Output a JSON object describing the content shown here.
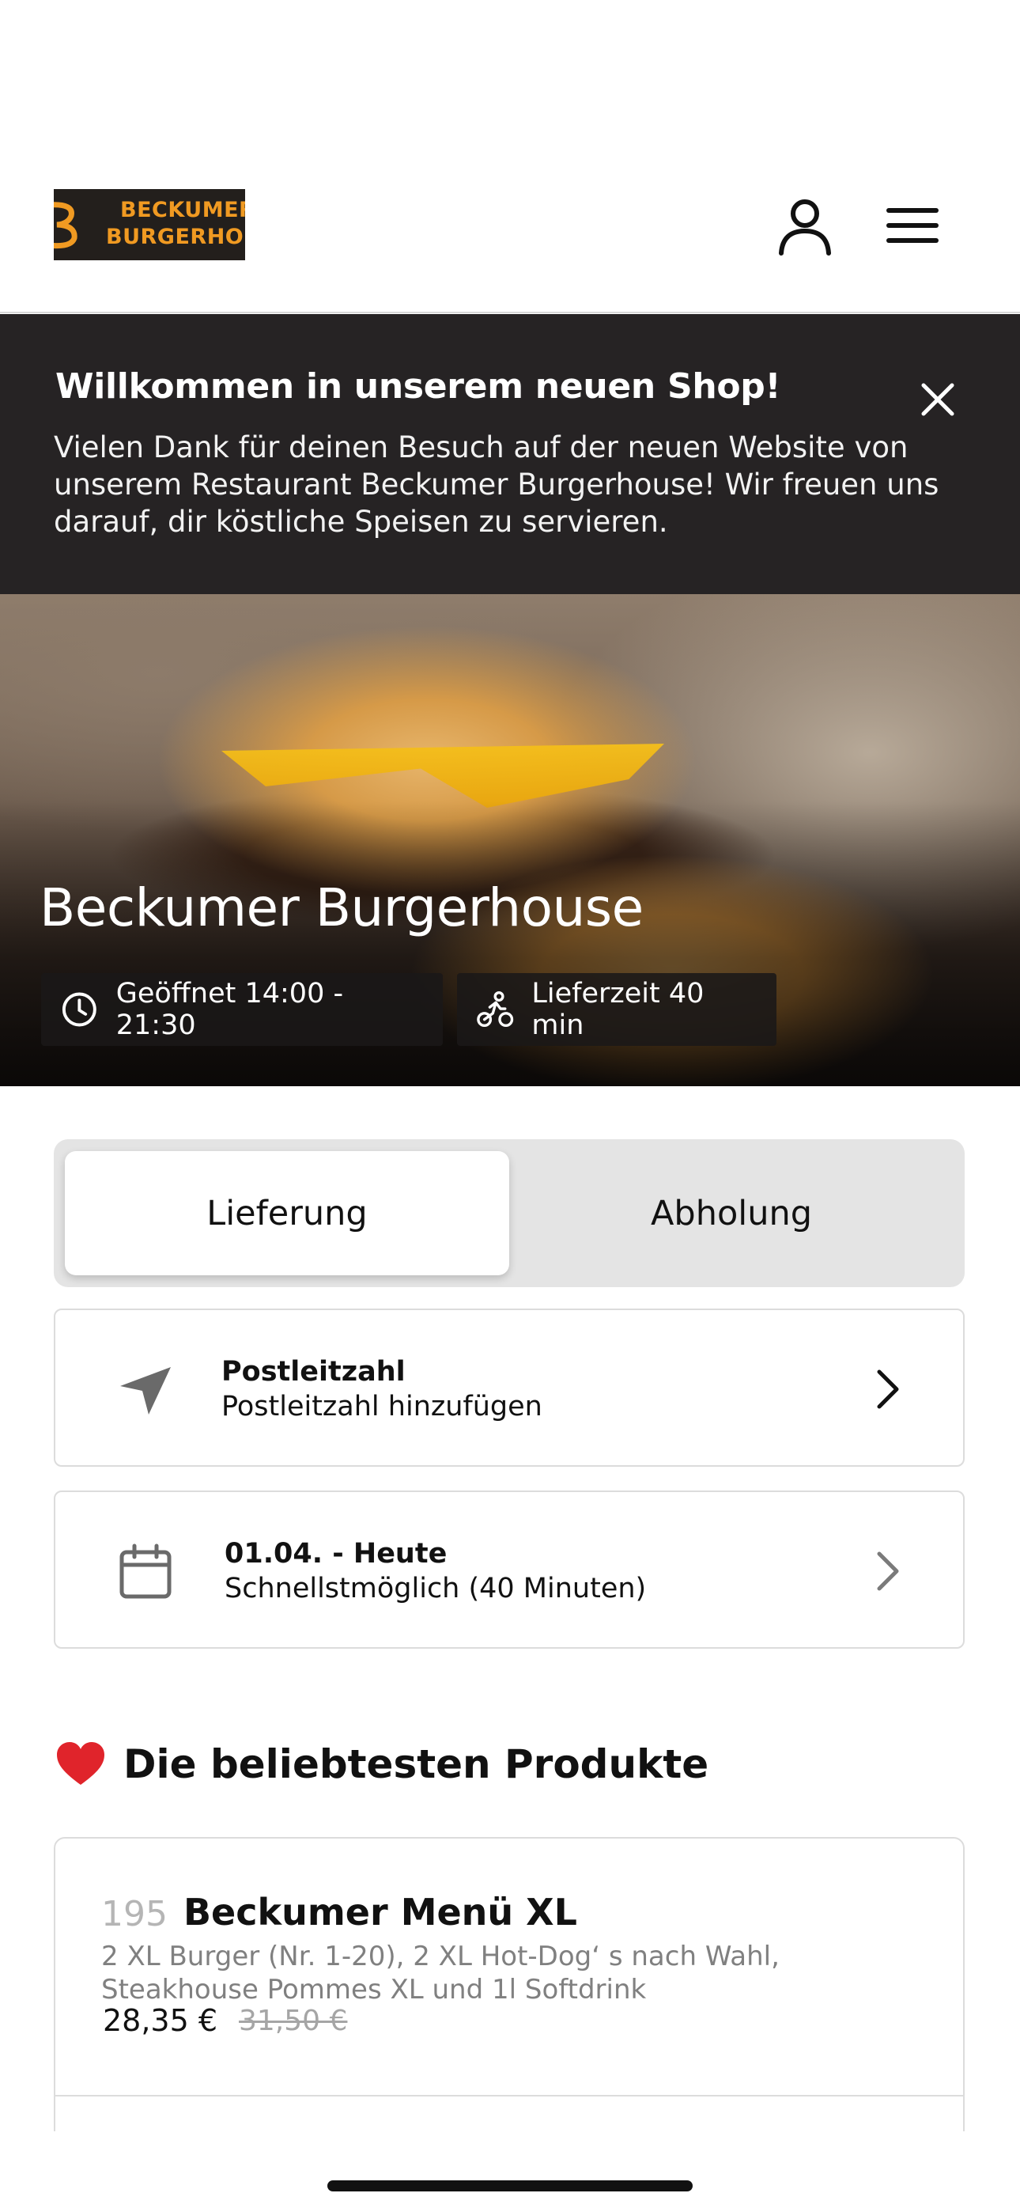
{
  "header": {
    "logo": {
      "line1": "BECKUMER",
      "line2": "BURGERHOUSE"
    },
    "icons": {
      "account": "user-icon",
      "menu": "hamburger-menu-icon"
    }
  },
  "banner": {
    "title": "Willkommen in unserem neuen Shop!",
    "text": "Vielen Dank für deinen Besuch auf der neuen Website von unserem Restaurant Beckumer Burgerhouse! Wir freuen uns darauf, dir köstliche Speisen zu servieren.",
    "close_icon": "close-icon"
  },
  "hero": {
    "title": "Beckumer Burgerhouse",
    "opening_hours": "Geöffnet 14:00 - 21:30",
    "delivery_time": "Lieferzeit 40 min"
  },
  "order_mode": {
    "options": [
      "Lieferung",
      "Abholung"
    ],
    "selected": "Lieferung"
  },
  "zip_card": {
    "title": "Postleitzahl",
    "subtitle": "Postleitzahl hinzufügen"
  },
  "date_card": {
    "title": "01.04. - Heute",
    "subtitle": "Schnellstmöglich (40 Minuten)"
  },
  "popular": {
    "title": "Die beliebtesten Produkte",
    "products": [
      {
        "number": "195",
        "name": "Beckumer Menü XL",
        "description": "2 XL Burger (Nr. 1-20), 2 XL Hot-Dog‘ s nach Wahl, Steakhouse Pommes XL und 1l Softdrink",
        "price": "28,35 €",
        "old_price": "31,50 €"
      }
    ]
  },
  "colors": {
    "brand_orange": "#f09a22",
    "banner_bg": "#262324",
    "heart_red": "#e0242b"
  }
}
